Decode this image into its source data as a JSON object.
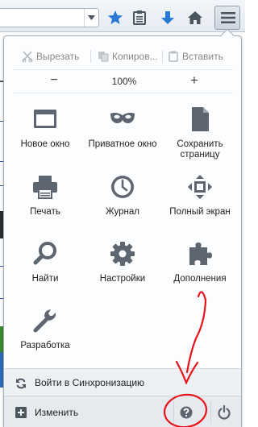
{
  "toolbar": {
    "icons": [
      "chevron-down-icon",
      "star-icon",
      "reading-list-icon",
      "download-icon",
      "home-icon",
      "menu-icon"
    ],
    "colors": {
      "accent": "#2a7ad5",
      "icon": "#4b5560"
    }
  },
  "menu": {
    "edit": {
      "cut": "Вырезать",
      "copy": "Копиров...",
      "paste": "Вставить"
    },
    "zoom": {
      "out": "−",
      "level": "100%",
      "in": "+"
    },
    "items": [
      {
        "label": "Новое окно",
        "icon": "new-window-icon"
      },
      {
        "label": "Приватное окно",
        "icon": "private-mask-icon"
      },
      {
        "label": "Сохранить страницу",
        "icon": "save-page-icon"
      },
      {
        "label": "Печать",
        "icon": "printer-icon"
      },
      {
        "label": "Журнал",
        "icon": "history-clock-icon"
      },
      {
        "label": "Полный экран",
        "icon": "fullscreen-icon"
      },
      {
        "label": "Найти",
        "icon": "search-icon"
      },
      {
        "label": "Настройки",
        "icon": "gear-icon"
      },
      {
        "label": "Дополнения",
        "icon": "puzzle-icon"
      },
      {
        "label": "Разработка",
        "icon": "wrench-icon"
      }
    ],
    "sync": {
      "label": "Войти в Синхронизацию",
      "icon": "sync-icon"
    },
    "footer": {
      "customize": "Изменить",
      "customize_icon": "plus-icon",
      "help_icon": "help-icon",
      "quit_icon": "power-icon"
    }
  },
  "annotation": {
    "color": "#e8121a",
    "kind": "hand-drawn arrow pointing at help button"
  }
}
